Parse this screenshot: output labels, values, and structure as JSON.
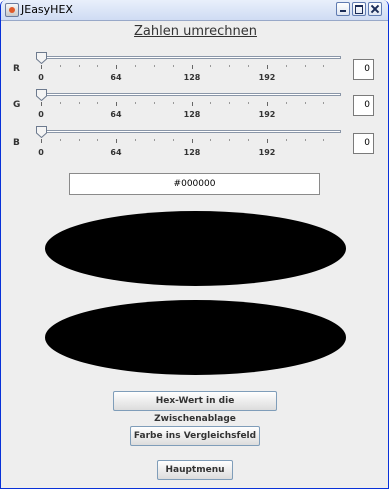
{
  "window": {
    "title": "JEasyHEX",
    "icon": "java-cup-icon",
    "controls": [
      "minimize-icon",
      "maximize-icon",
      "close-icon"
    ]
  },
  "heading": "Zahlen umrechnen",
  "sliders": [
    {
      "label": "R",
      "value": "0",
      "level": 0,
      "ticks": [
        "0",
        "64",
        "128",
        "192"
      ]
    },
    {
      "label": "G",
      "value": "0",
      "level": 0,
      "ticks": [
        "0",
        "64",
        "128",
        "192"
      ]
    },
    {
      "label": "B",
      "value": "0",
      "level": 0,
      "ticks": [
        "0",
        "64",
        "128",
        "192"
      ]
    }
  ],
  "hex_value": "#000000",
  "preview_color": "#000000",
  "compare_color": "#000000",
  "buttons": {
    "copy_hex": "Hex-Wert in die Zwischenablage",
    "to_compare": "Farbe ins Vergleichsfeld",
    "main_menu": "Hauptmenu"
  }
}
